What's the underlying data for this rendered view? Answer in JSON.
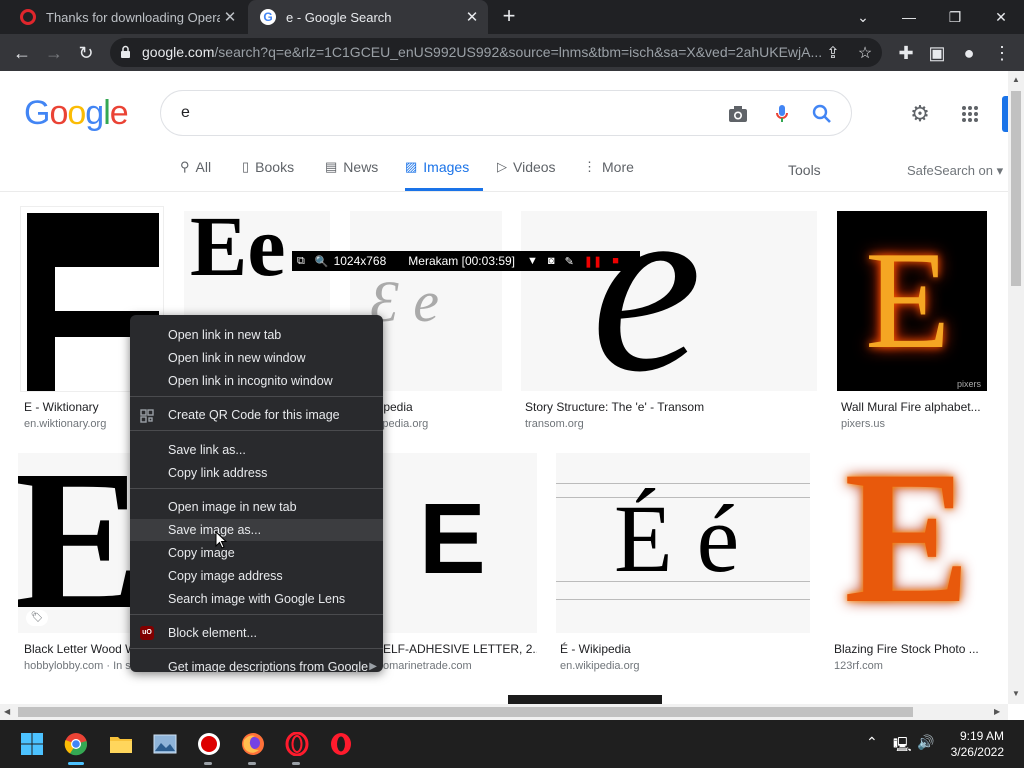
{
  "browser": {
    "tabs": [
      {
        "title": "Thanks for downloading Opera",
        "favicon": "opera-icon",
        "active": false
      },
      {
        "title": "e - Google Search",
        "favicon": "google-icon",
        "active": true
      }
    ],
    "url_host": "google.com",
    "url_rest": "/search?q=e&rlz=1C1GCEU_enUS992US992&source=lnms&tbm=isch&sa=X&ved=2ahUKEwjA..."
  },
  "google": {
    "logo_letters": [
      "G",
      "o",
      "o",
      "g",
      "l",
      "e"
    ],
    "query": "e",
    "nav": {
      "all": "All",
      "books": "Books",
      "news": "News",
      "images": "Images",
      "videos": "Videos",
      "more": "More",
      "tools": "Tools",
      "safesearch": "SafeSearch on"
    }
  },
  "results": {
    "row1": [
      {
        "glyph": "E",
        "caption": "E - Wiktionary",
        "source": "en.wiktionary.org"
      },
      {
        "glyph": "Ee",
        "caption": "",
        "source": ""
      },
      {
        "glyph": "Ɛ e",
        "caption": "ikipedia",
        "source": "ikipedia.org"
      },
      {
        "glyph": "e",
        "caption": "Story Structure: The 'e' - Transom",
        "source": "transom.org"
      },
      {
        "glyph": "E",
        "caption": "Wall Mural Fire alphabet...",
        "source": "pixers.us",
        "watermark": "pixers"
      }
    ],
    "row2": [
      {
        "glyph": "E",
        "caption": "Black Letter Wood W",
        "source": "hobbylobby.com · In s"
      },
      {
        "glyph": "E",
        "caption": "ELF-ADHESIVE LETTER, 2...",
        "source": "omarinetrade.com"
      },
      {
        "glyph": "É é",
        "caption": "É - Wikipedia",
        "source": "en.wikipedia.org"
      },
      {
        "glyph": "E",
        "caption": "Blazing Fire Stock Photo ...",
        "source": "123rf.com"
      }
    ]
  },
  "recorder": {
    "resolution": "1024x768",
    "label": "Merakam [00:03:59]"
  },
  "context_menu": {
    "items": [
      "Open link in new tab",
      "Open link in new window",
      "Open link in incognito window",
      "Create QR Code for this image",
      "Save link as...",
      "Copy link address",
      "Open image in new tab",
      "Save image as...",
      "Copy image",
      "Copy image address",
      "Search image with Google Lens",
      "Block element...",
      "Get image descriptions from Google"
    ],
    "highlighted": "Save image as..."
  },
  "taskbar": {
    "time": "9:19 AM",
    "date": "3/26/2022"
  },
  "colors": {
    "chrome_dark": "#202124",
    "toolbar": "#35363a",
    "google_blue": "#4285f4",
    "menu_bg": "#292a2d"
  }
}
